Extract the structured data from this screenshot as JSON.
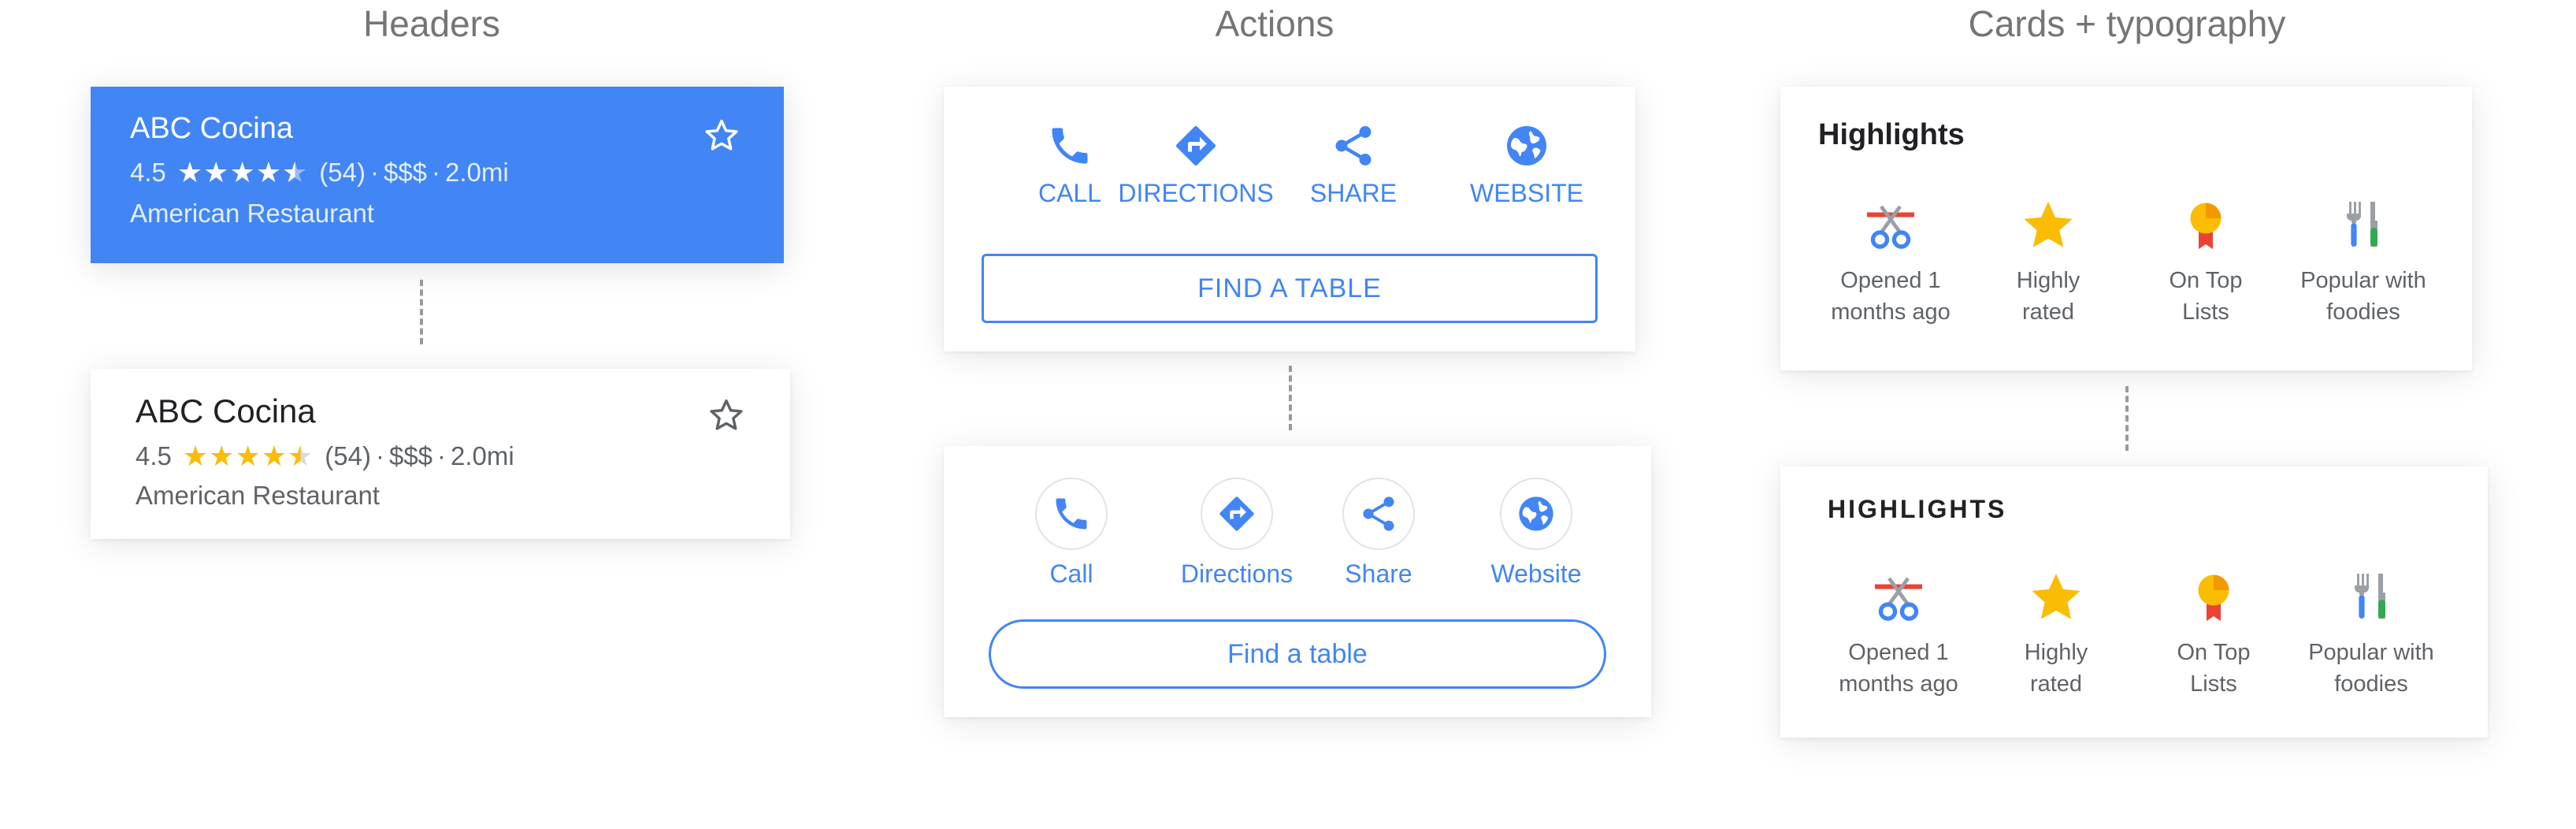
{
  "columns": {
    "headers": "Headers",
    "actions": "Actions",
    "cards": "Cards + typography"
  },
  "colors": {
    "accent": "#4285f4",
    "star_gold": "#fbbc04",
    "text_secondary": "#5f6368"
  },
  "place": {
    "name": "ABC Cocina",
    "rating": "4.5",
    "rating_value": 4.5,
    "reviews": "(54)",
    "price": "$$$",
    "distance": "2.0mi",
    "dot": "·",
    "category": "American Restaurant"
  },
  "actions_caps": {
    "call": "CALL",
    "directions": "DIRECTIONS",
    "share": "SHARE",
    "website": "WEBSITE",
    "find_table": "FIND A TABLE"
  },
  "actions_title": {
    "call": "Call",
    "directions": "Directions",
    "share": "Share",
    "website": "Website",
    "find_table": "Find a table"
  },
  "highlights": {
    "title": "Highlights",
    "title_caps": "HIGHLIGHTS",
    "items": [
      {
        "line1": "Opened 1",
        "line2": "months ago",
        "icon": "ribbon-cut-icon"
      },
      {
        "line1": "Highly",
        "line2": "rated",
        "icon": "star-icon"
      },
      {
        "line1": "On Top",
        "line2": "Lists",
        "icon": "medal-icon"
      },
      {
        "line1": "Popular with",
        "line2": "foodies",
        "icon": "fork-knife-icon"
      }
    ]
  }
}
